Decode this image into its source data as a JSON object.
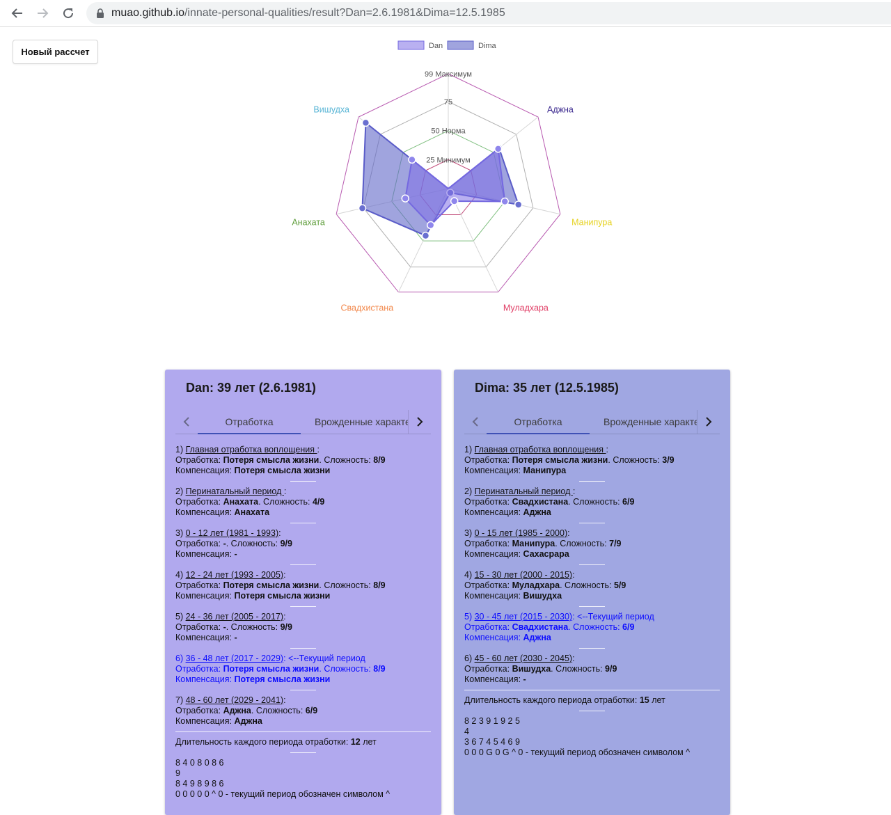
{
  "browser": {
    "url_host": "muao.github.io",
    "url_path": "/innate-personal-qualities/result?Dan=2.6.1981&Dima=12.5.1985"
  },
  "new_calc_label": "Новый рассчет",
  "chart_data": {
    "type": "radar",
    "axes": [
      "Аджна",
      "Манипура",
      "Муладхара",
      "Свадхистана",
      "Анахата",
      "Вишудха"
    ],
    "axis_colors": [
      "#3c2a8f",
      "#e6d21f",
      "#e03c64",
      "#f2874a",
      "#5f9e3c",
      "#5ab6d6"
    ],
    "ticks": [
      {
        "value": 25,
        "label": "25 Минимум"
      },
      {
        "value": 50,
        "label": "50 Норма"
      },
      {
        "value": 75,
        "label": "75"
      },
      {
        "value": 99,
        "label": "99 Максимум"
      }
    ],
    "max": 99,
    "series": [
      {
        "name": "Dan",
        "values": [
          55,
          50,
          12,
          35,
          38,
          40
        ],
        "fill": "rgba(128,112,230,0.55)",
        "stroke": "#7468e0"
      },
      {
        "name": "Dima",
        "values": [
          56,
          62,
          4,
          45,
          76,
          91
        ],
        "fill": "rgba(96,104,200,0.6)",
        "stroke": "#5a5cc8"
      }
    ]
  },
  "dan": {
    "title": "Dan: 39 лет (2.6.1981)",
    "tab_active": "Отработка",
    "tab_second": "Врожденные характеристики",
    "entries": [
      {
        "num": "1) ",
        "link": "Главная отработка воплощения ",
        "after": ":",
        "tail": "",
        "otr_value": "Потеря смысла жизни",
        "diff": "8/9",
        "comp": "Потеря смысла жизни",
        "current": false
      },
      {
        "num": "2) ",
        "link": "Перинатальный период ",
        "after": ":",
        "tail": "",
        "otr_value": "Анахата",
        "diff": "4/9",
        "comp": "Анахата",
        "current": false
      },
      {
        "num": "3) ",
        "link": "0 - 12 лет (1981 - 1993)",
        "after": ":",
        "tail": "",
        "otr_value": "-",
        "diff": "9/9",
        "comp": "-",
        "current": false
      },
      {
        "num": "4) ",
        "link": "12 - 24 лет (1993 - 2005)",
        "after": ":",
        "tail": "",
        "otr_value": "Потеря смысла жизни",
        "diff": "8/9",
        "comp": "Потеря смысла жизни",
        "current": false
      },
      {
        "num": "5) ",
        "link": "24 - 36 лет (2005 - 2017)",
        "after": ":",
        "tail": "",
        "otr_value": "-",
        "diff": "9/9",
        "comp": "-",
        "current": false
      },
      {
        "num": "6) ",
        "link": "36 - 48 лет (2017 - 2029)",
        "after": ":",
        "tail": " <--Текущий период",
        "otr_value": "Потеря смысла жизни",
        "diff": "8/9",
        "comp": "Потеря смысла жизни",
        "current": true
      },
      {
        "num": "7) ",
        "link": "48 - 60 лет (2029 - 2041)",
        "after": ":",
        "tail": "",
        "otr_value": "Аджна",
        "diff": "6/9",
        "comp": "Аджна",
        "current": false
      }
    ],
    "duration_label": "Длительность каждого периода отработки: ",
    "duration_value": "12",
    "duration_unit": " лет",
    "digits": [
      "8 4 0 8 0 8 6",
      "9",
      "8 4 9 8 9 8 6",
      "0 0 0 0 0 ^ 0 - текущий период обозначен символом ^"
    ]
  },
  "dima": {
    "title": "Dima: 35 лет (12.5.1985)",
    "tab_active": "Отработка",
    "tab_second": "Врожденные характеристики",
    "entries": [
      {
        "num": "1) ",
        "link": "Главная отработка воплощения ",
        "after": ":",
        "tail": "",
        "otr_value": "Потеря смысла жизни",
        "diff": "3/9",
        "comp": "Манипура",
        "current": false
      },
      {
        "num": "2) ",
        "link": "Перинатальный период ",
        "after": ":",
        "tail": "",
        "otr_value": "Свадхистана",
        "diff": "6/9",
        "comp": "Аджна",
        "current": false
      },
      {
        "num": "3) ",
        "link": "0 - 15 лет (1985 - 2000)",
        "after": ":",
        "tail": "",
        "otr_value": "Манипура",
        "diff": "7/9",
        "comp": "Сахасрара",
        "current": false
      },
      {
        "num": "4) ",
        "link": "15 - 30 лет (2000 - 2015)",
        "after": ":",
        "tail": "",
        "otr_value": "Муладхара",
        "diff": "5/9",
        "comp": "Вишудха",
        "current": false
      },
      {
        "num": "5) ",
        "link": "30 - 45 лет (2015 - 2030)",
        "after": ":",
        "tail": " <--Текущий период",
        "otr_value": "Свадхистана",
        "diff": "6/9",
        "comp": "Аджна",
        "current": true
      },
      {
        "num": "6) ",
        "link": "45 - 60 лет (2030 - 2045)",
        "after": ":",
        "tail": "",
        "otr_value": "Вишудха",
        "diff": "9/9",
        "comp": "-",
        "current": false
      }
    ],
    "duration_label": "Длительность каждого периода отработки: ",
    "duration_value": "15",
    "duration_unit": " лет",
    "digits": [
      "8 2 3 9 1 9 2 5",
      "4",
      "3 6 7 4 5 4 6 9",
      "0 0 0 G 0 G ^ 0 - текущий период обозначен символом ^"
    ]
  },
  "labels": {
    "otr": "Отработка: ",
    "diff": ". Сложность: ",
    "comp": "Компенсация: "
  }
}
